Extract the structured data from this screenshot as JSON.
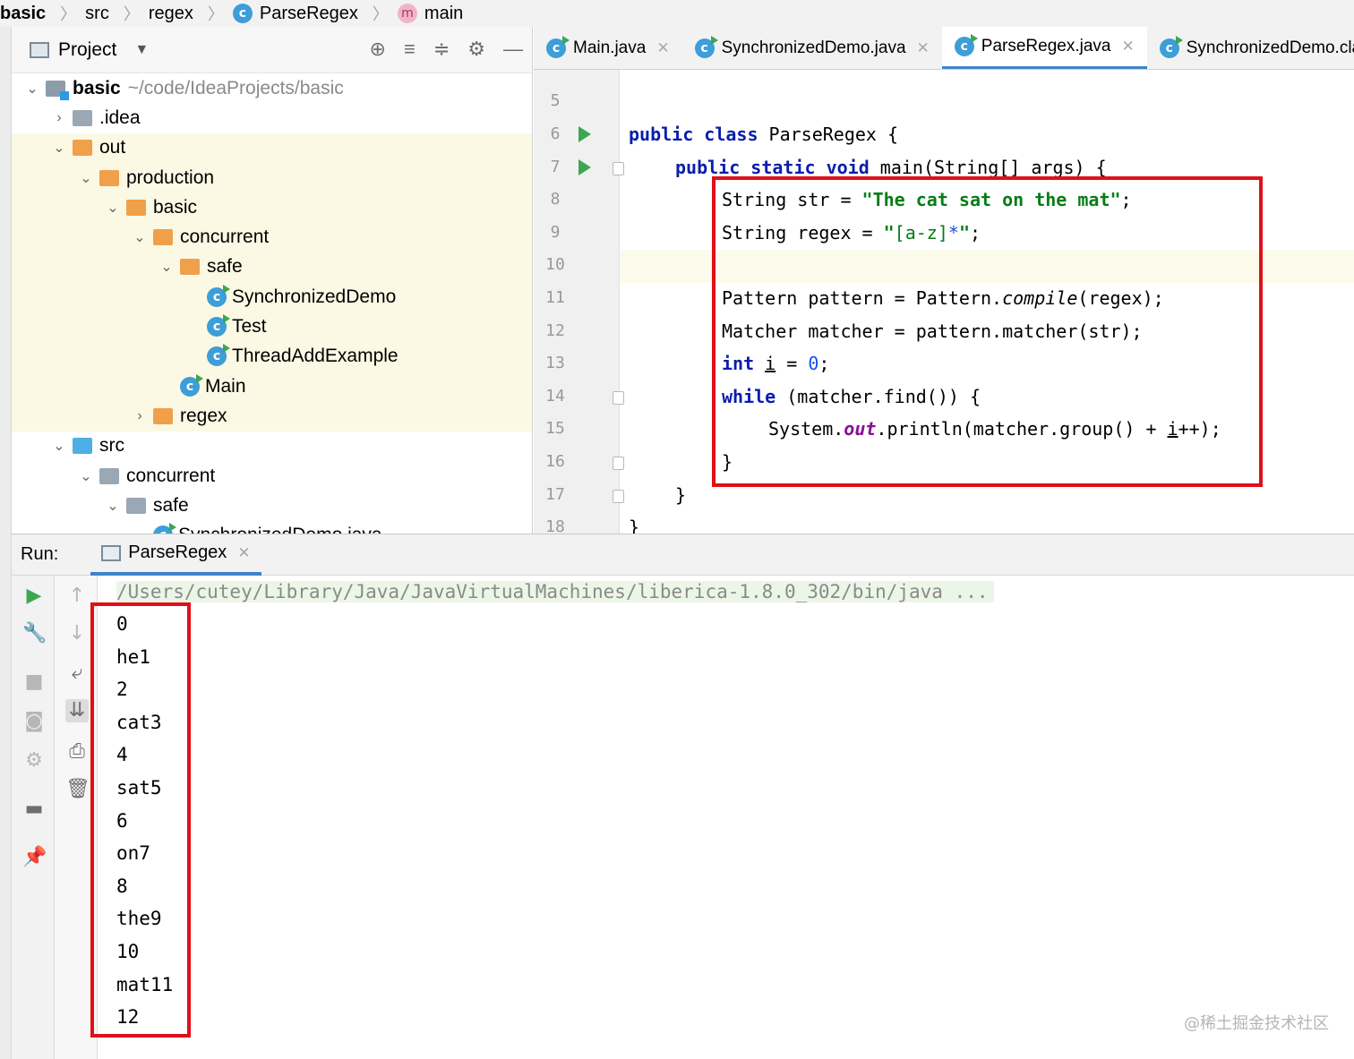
{
  "breadcrumb": {
    "items": [
      "basic",
      "src",
      "regex",
      "ParseRegex",
      "main"
    ]
  },
  "project": {
    "title": "Project",
    "tree": [
      {
        "label": "basic",
        "suffix": "~/code/IdeaProjects/basic",
        "arrow": "v",
        "icon": "project",
        "bold": true
      },
      {
        "label": ".idea",
        "arrow": ">",
        "icon": "folder-grey"
      },
      {
        "label": "out",
        "arrow": "v",
        "icon": "folder-orange"
      },
      {
        "label": "production",
        "arrow": "v",
        "icon": "folder-orange"
      },
      {
        "label": "basic",
        "arrow": "v",
        "icon": "folder-orange"
      },
      {
        "label": "concurrent",
        "arrow": "v",
        "icon": "folder-orange"
      },
      {
        "label": "safe",
        "arrow": "v",
        "icon": "folder-orange"
      },
      {
        "label": "SynchronizedDemo",
        "arrow": "",
        "icon": "class"
      },
      {
        "label": "Test",
        "arrow": "",
        "icon": "class"
      },
      {
        "label": "ThreadAddExample",
        "arrow": "",
        "icon": "class"
      },
      {
        "label": "Main",
        "arrow": "",
        "icon": "class"
      },
      {
        "label": "regex",
        "arrow": ">",
        "icon": "folder-orange"
      },
      {
        "label": "src",
        "arrow": "v",
        "icon": "folder-blue"
      },
      {
        "label": "concurrent",
        "arrow": "v",
        "icon": "folder-grey"
      },
      {
        "label": "safe",
        "arrow": "v",
        "icon": "folder-grey"
      },
      {
        "label": "SynchronizedDemo.java",
        "arrow": "v",
        "icon": "class"
      }
    ]
  },
  "editor_tabs": [
    {
      "label": "Main.java",
      "active": false
    },
    {
      "label": "SynchronizedDemo.java",
      "active": false
    },
    {
      "label": "ParseRegex.java",
      "active": true
    },
    {
      "label": "SynchronizedDemo.class",
      "active": false
    }
  ],
  "editor": {
    "line_numbers": [
      "5",
      "6",
      "7",
      "8",
      "9",
      "10",
      "11",
      "12",
      "13",
      "14",
      "15",
      "16",
      "17",
      "18"
    ],
    "code": {
      "l6": [
        "public class ",
        "ParseRegex {"
      ],
      "l7": [
        "public static void ",
        "main(String[] args) {"
      ],
      "l8": [
        "String str = ",
        "\"The cat sat on the mat\"",
        ";"
      ],
      "l9": [
        "String regex = ",
        "\"",
        "[a-z]",
        "*",
        "\"",
        ";"
      ],
      "l11": [
        "Pattern pattern = Pattern.",
        "compile",
        "(regex);"
      ],
      "l12": [
        "Matcher matcher = pattern.matcher(str);"
      ],
      "l13": [
        "int ",
        "i",
        " = ",
        "0",
        ";"
      ],
      "l14": [
        "while ",
        "(matcher.find()) {"
      ],
      "l15": [
        "System.",
        "out",
        ".println(matcher.group() + ",
        "i",
        "++);"
      ],
      "l16": [
        "}"
      ],
      "l17": [
        "}"
      ],
      "l18": [
        "}"
      ]
    }
  },
  "run": {
    "label": "Run:",
    "tab": "ParseRegex",
    "command": "/Users/cutey/Library/Java/JavaVirtualMachines/liberica-1.8.0_302/bin/java ...",
    "output": [
      "0",
      "he1",
      "2",
      "cat3",
      "4",
      "sat5",
      "6",
      "on7",
      "8",
      "the9",
      "10",
      "mat11",
      "12"
    ]
  },
  "watermark": "@稀土掘金技术社区",
  "colors": {
    "highlight_box": "#e0101a",
    "keyword": "#0a1dab",
    "string": "#067d17",
    "tab_underline": "#4083c9"
  }
}
